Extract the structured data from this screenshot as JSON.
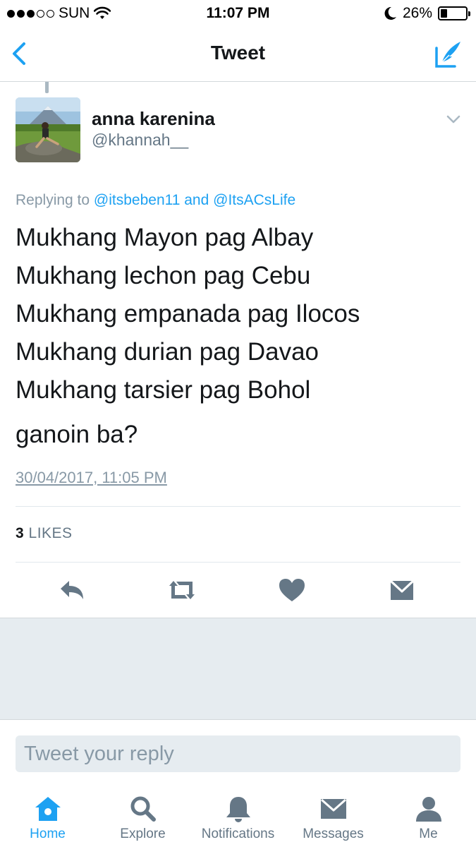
{
  "status_bar": {
    "carrier": "SUN",
    "time": "11:07 PM",
    "battery_percent_label": "26%",
    "battery_level": 0.26
  },
  "nav": {
    "title": "Tweet"
  },
  "tweet": {
    "user_name": "anna karenina",
    "user_handle": "@khannah__",
    "reply_prefix": "Replying to ",
    "reply_mention_1": "@itsbeben11",
    "reply_and": " and ",
    "reply_mention_2": "@ItsACsLife",
    "lines": [
      "Mukhang Mayon pag Albay",
      "Mukhang lechon pag Cebu",
      "Mukhang empanada pag Ilocos",
      "Mukhang durian pag Davao",
      "Mukhang tarsier pag Bohol"
    ],
    "extra_line": "ganoin ba?",
    "timestamp": "30/04/2017, 11:05 PM",
    "likes_count": "3",
    "likes_label": "LIKES"
  },
  "actions": {
    "icons": [
      "reply-icon",
      "retweet-icon",
      "like-icon",
      "direct-message-icon"
    ]
  },
  "reply_box": {
    "placeholder": "Tweet your reply"
  },
  "tab_bar": {
    "tabs": [
      {
        "label": "Home",
        "icon": "home-icon",
        "active": true
      },
      {
        "label": "Explore",
        "icon": "search-icon",
        "active": false
      },
      {
        "label": "Notifications",
        "icon": "bell-icon",
        "active": false
      },
      {
        "label": "Messages",
        "icon": "envelope-icon",
        "active": false
      },
      {
        "label": "Me",
        "icon": "person-icon",
        "active": false
      }
    ]
  },
  "colors": {
    "accent": "#1da1f2",
    "icon_gray": "#657786",
    "muted_text": "#8899a6",
    "background_gray": "#e6ecf0"
  }
}
